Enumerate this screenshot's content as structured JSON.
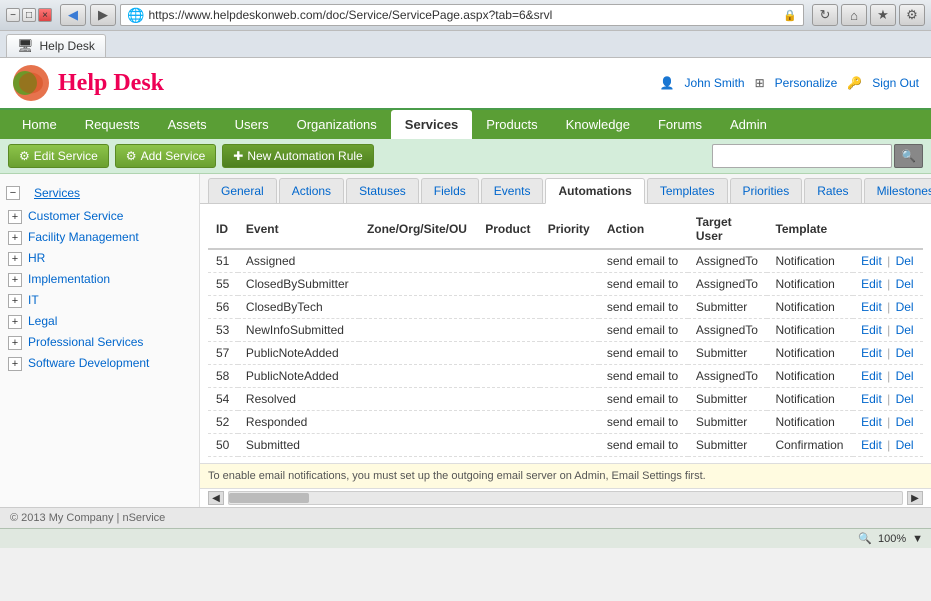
{
  "browser": {
    "url": "https://www.helpdeskonweb.com/doc/Service/ServicePage.aspx?tab=6&srvl",
    "tab_title": "Help Desk",
    "zoom": "100%"
  },
  "header": {
    "logo_text": "Help Desk",
    "user_name": "John Smith",
    "personalize_label": "Personalize",
    "signout_label": "Sign Out"
  },
  "nav": {
    "items": [
      {
        "label": "Home",
        "active": false
      },
      {
        "label": "Requests",
        "active": false
      },
      {
        "label": "Assets",
        "active": false
      },
      {
        "label": "Users",
        "active": false
      },
      {
        "label": "Organizations",
        "active": false
      },
      {
        "label": "Services",
        "active": true
      },
      {
        "label": "Products",
        "active": false
      },
      {
        "label": "Knowledge",
        "active": false
      },
      {
        "label": "Forums",
        "active": false
      },
      {
        "label": "Admin",
        "active": false
      }
    ]
  },
  "toolbar": {
    "edit_service_label": "Edit Service",
    "add_service_label": "Add Service",
    "new_rule_label": "New Automation Rule",
    "search_placeholder": ""
  },
  "sidebar": {
    "root_label": "Services",
    "items": [
      {
        "label": "Customer Service",
        "has_children": true
      },
      {
        "label": "Facility Management",
        "has_children": true
      },
      {
        "label": "HR",
        "has_children": true
      },
      {
        "label": "Implementation",
        "has_children": true
      },
      {
        "label": "IT",
        "has_children": true
      },
      {
        "label": "Legal",
        "has_children": true
      },
      {
        "label": "Professional Services",
        "has_children": true
      },
      {
        "label": "Software Development",
        "has_children": true
      }
    ]
  },
  "tabs": {
    "items": [
      {
        "label": "General",
        "active": false
      },
      {
        "label": "Actions",
        "active": false
      },
      {
        "label": "Statuses",
        "active": false
      },
      {
        "label": "Fields",
        "active": false
      },
      {
        "label": "Events",
        "active": false
      },
      {
        "label": "Automations",
        "active": true
      },
      {
        "label": "Templates",
        "active": false
      },
      {
        "label": "Priorities",
        "active": false
      },
      {
        "label": "Rates",
        "active": false
      },
      {
        "label": "Milestones",
        "active": false
      }
    ]
  },
  "table": {
    "columns": [
      "ID",
      "Event",
      "Zone/Org/Site/OU",
      "Product",
      "Priority",
      "Action",
      "Target User",
      "Template",
      ""
    ],
    "rows": [
      {
        "id": "51",
        "event": "Assigned",
        "zone": "",
        "product": "",
        "priority": "",
        "action": "send email to",
        "target_user": "AssignedTo",
        "template": "Notification"
      },
      {
        "id": "55",
        "event": "ClosedBySubmitter",
        "zone": "",
        "product": "",
        "priority": "",
        "action": "send email to",
        "target_user": "AssignedTo",
        "template": "Notification"
      },
      {
        "id": "56",
        "event": "ClosedByTech",
        "zone": "",
        "product": "",
        "priority": "",
        "action": "send email to",
        "target_user": "Submitter",
        "template": "Notification"
      },
      {
        "id": "53",
        "event": "NewInfoSubmitted",
        "zone": "",
        "product": "",
        "priority": "",
        "action": "send email to",
        "target_user": "AssignedTo",
        "template": "Notification"
      },
      {
        "id": "57",
        "event": "PublicNoteAdded",
        "zone": "",
        "product": "",
        "priority": "",
        "action": "send email to",
        "target_user": "Submitter",
        "template": "Notification"
      },
      {
        "id": "58",
        "event": "PublicNoteAdded",
        "zone": "",
        "product": "",
        "priority": "",
        "action": "send email to",
        "target_user": "AssignedTo",
        "template": "Notification"
      },
      {
        "id": "54",
        "event": "Resolved",
        "zone": "",
        "product": "",
        "priority": "",
        "action": "send email to",
        "target_user": "Submitter",
        "template": "Notification"
      },
      {
        "id": "52",
        "event": "Responded",
        "zone": "",
        "product": "",
        "priority": "",
        "action": "send email to",
        "target_user": "Submitter",
        "template": "Notification"
      },
      {
        "id": "50",
        "event": "Submitted",
        "zone": "",
        "product": "",
        "priority": "",
        "action": "send email to",
        "target_user": "Submitter",
        "template": "Confirmation"
      }
    ],
    "edit_label": "Edit",
    "del_label": "Del"
  },
  "info_message": "To enable email notifications, you must set up the outgoing email server on Admin, Email Settings first.",
  "footer": {
    "text": "© 2013 My Company | nService"
  },
  "status_bar": {
    "zoom_label": "100%"
  }
}
